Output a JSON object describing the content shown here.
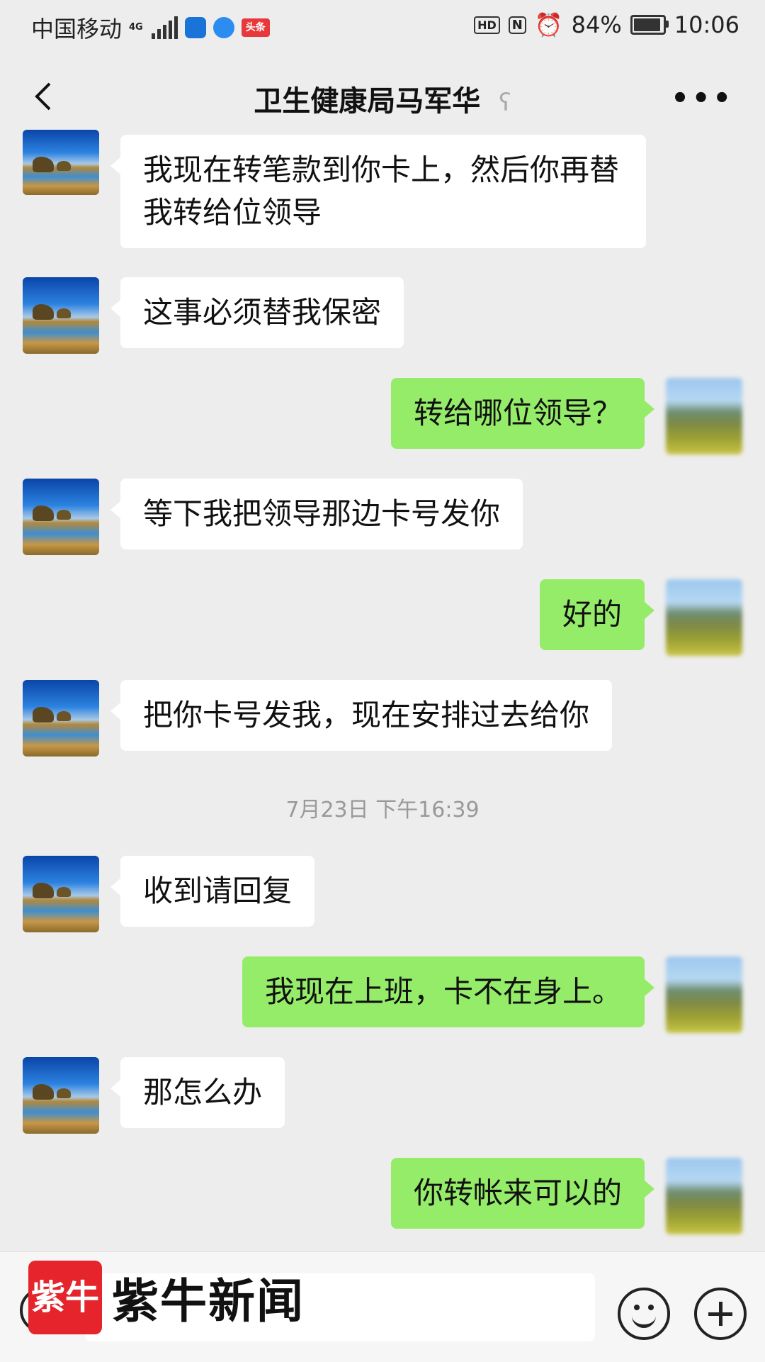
{
  "status_bar": {
    "carrier": "中国移动",
    "network": "4G",
    "app_badge_toutiao": "头条",
    "hd": "HD",
    "nfc": "N",
    "battery": "84%",
    "time": "10:06"
  },
  "header": {
    "title": "卫生健康局马军华"
  },
  "messages": [
    {
      "side": "in",
      "text": "我现在转笔款到你卡上，然后你再替我转给位领导"
    },
    {
      "side": "in",
      "text": "这事必须替我保密"
    },
    {
      "side": "out",
      "text": "转给哪位领导？"
    },
    {
      "side": "in",
      "text": "等下我把领导那边卡号发你"
    },
    {
      "side": "out",
      "text": "好的"
    },
    {
      "side": "in",
      "text": "把你卡号发我，现在安排过去给你"
    },
    {
      "side": "in",
      "text": "收到请回复"
    },
    {
      "side": "out",
      "text": "我现在上班，卡不在身上。"
    },
    {
      "side": "in",
      "text": "那怎么办"
    },
    {
      "side": "out",
      "text": "你转帐来可以的"
    }
  ],
  "timestamp": "7月23日 下午16:39",
  "watermark": {
    "logo": "紫牛",
    "text": "紫牛新闻"
  }
}
